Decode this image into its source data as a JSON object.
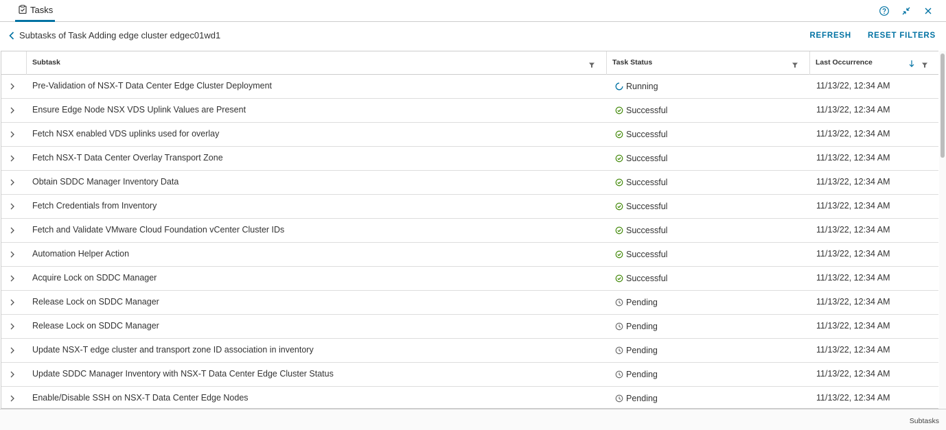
{
  "tab": {
    "label": "Tasks",
    "icon": "clipboard-icon"
  },
  "window_controls": [
    {
      "name": "help-icon"
    },
    {
      "name": "collapse-icon"
    },
    {
      "name": "close-icon"
    }
  ],
  "header": {
    "title": "Subtasks of Task Adding edge cluster edgec01wd1",
    "refresh_label": "REFRESH",
    "reset_filters_label": "RESET FILTERS"
  },
  "columns": {
    "subtask": "Subtask",
    "status": "Task Status",
    "last": "Last Occurrence"
  },
  "colors": {
    "accent": "#0072a3",
    "success": "#3c8500",
    "running": "#0072a3",
    "pending": "#666666"
  },
  "rows": [
    {
      "subtask": "Pre-Validation of NSX-T Data Center Edge Cluster Deployment",
      "status": "Running",
      "status_icon": "spinner-icon",
      "last": "11/13/22, 12:34 AM"
    },
    {
      "subtask": "Ensure Edge Node NSX VDS Uplink Values are Present",
      "status": "Successful",
      "status_icon": "check-circle-icon",
      "last": "11/13/22, 12:34 AM"
    },
    {
      "subtask": "Fetch NSX enabled VDS uplinks used for overlay",
      "status": "Successful",
      "status_icon": "check-circle-icon",
      "last": "11/13/22, 12:34 AM"
    },
    {
      "subtask": "Fetch NSX-T Data Center Overlay Transport Zone",
      "status": "Successful",
      "status_icon": "check-circle-icon",
      "last": "11/13/22, 12:34 AM"
    },
    {
      "subtask": "Obtain SDDC Manager Inventory Data",
      "status": "Successful",
      "status_icon": "check-circle-icon",
      "last": "11/13/22, 12:34 AM"
    },
    {
      "subtask": "Fetch Credentials from Inventory",
      "status": "Successful",
      "status_icon": "check-circle-icon",
      "last": "11/13/22, 12:34 AM"
    },
    {
      "subtask": "Fetch and Validate VMware Cloud Foundation vCenter Cluster IDs",
      "status": "Successful",
      "status_icon": "check-circle-icon",
      "last": "11/13/22, 12:34 AM"
    },
    {
      "subtask": "Automation Helper Action",
      "status": "Successful",
      "status_icon": "check-circle-icon",
      "last": "11/13/22, 12:34 AM"
    },
    {
      "subtask": "Acquire Lock on SDDC Manager",
      "status": "Successful",
      "status_icon": "check-circle-icon",
      "last": "11/13/22, 12:34 AM"
    },
    {
      "subtask": "Release Lock on SDDC Manager",
      "status": "Pending",
      "status_icon": "clock-icon",
      "last": "11/13/22, 12:34 AM"
    },
    {
      "subtask": "Release Lock on SDDC Manager",
      "status": "Pending",
      "status_icon": "clock-icon",
      "last": "11/13/22, 12:34 AM"
    },
    {
      "subtask": "Update NSX-T edge cluster and transport zone ID association in inventory",
      "status": "Pending",
      "status_icon": "clock-icon",
      "last": "11/13/22, 12:34 AM"
    },
    {
      "subtask": "Update SDDC Manager Inventory with NSX-T Data Center Edge Cluster Status",
      "status": "Pending",
      "status_icon": "clock-icon",
      "last": "11/13/22, 12:34 AM"
    },
    {
      "subtask": "Enable/Disable SSH on NSX-T Data Center Edge Nodes",
      "status": "Pending",
      "status_icon": "clock-icon",
      "last": "11/13/22, 12:34 AM"
    }
  ],
  "footer": {
    "label": "Subtasks"
  }
}
